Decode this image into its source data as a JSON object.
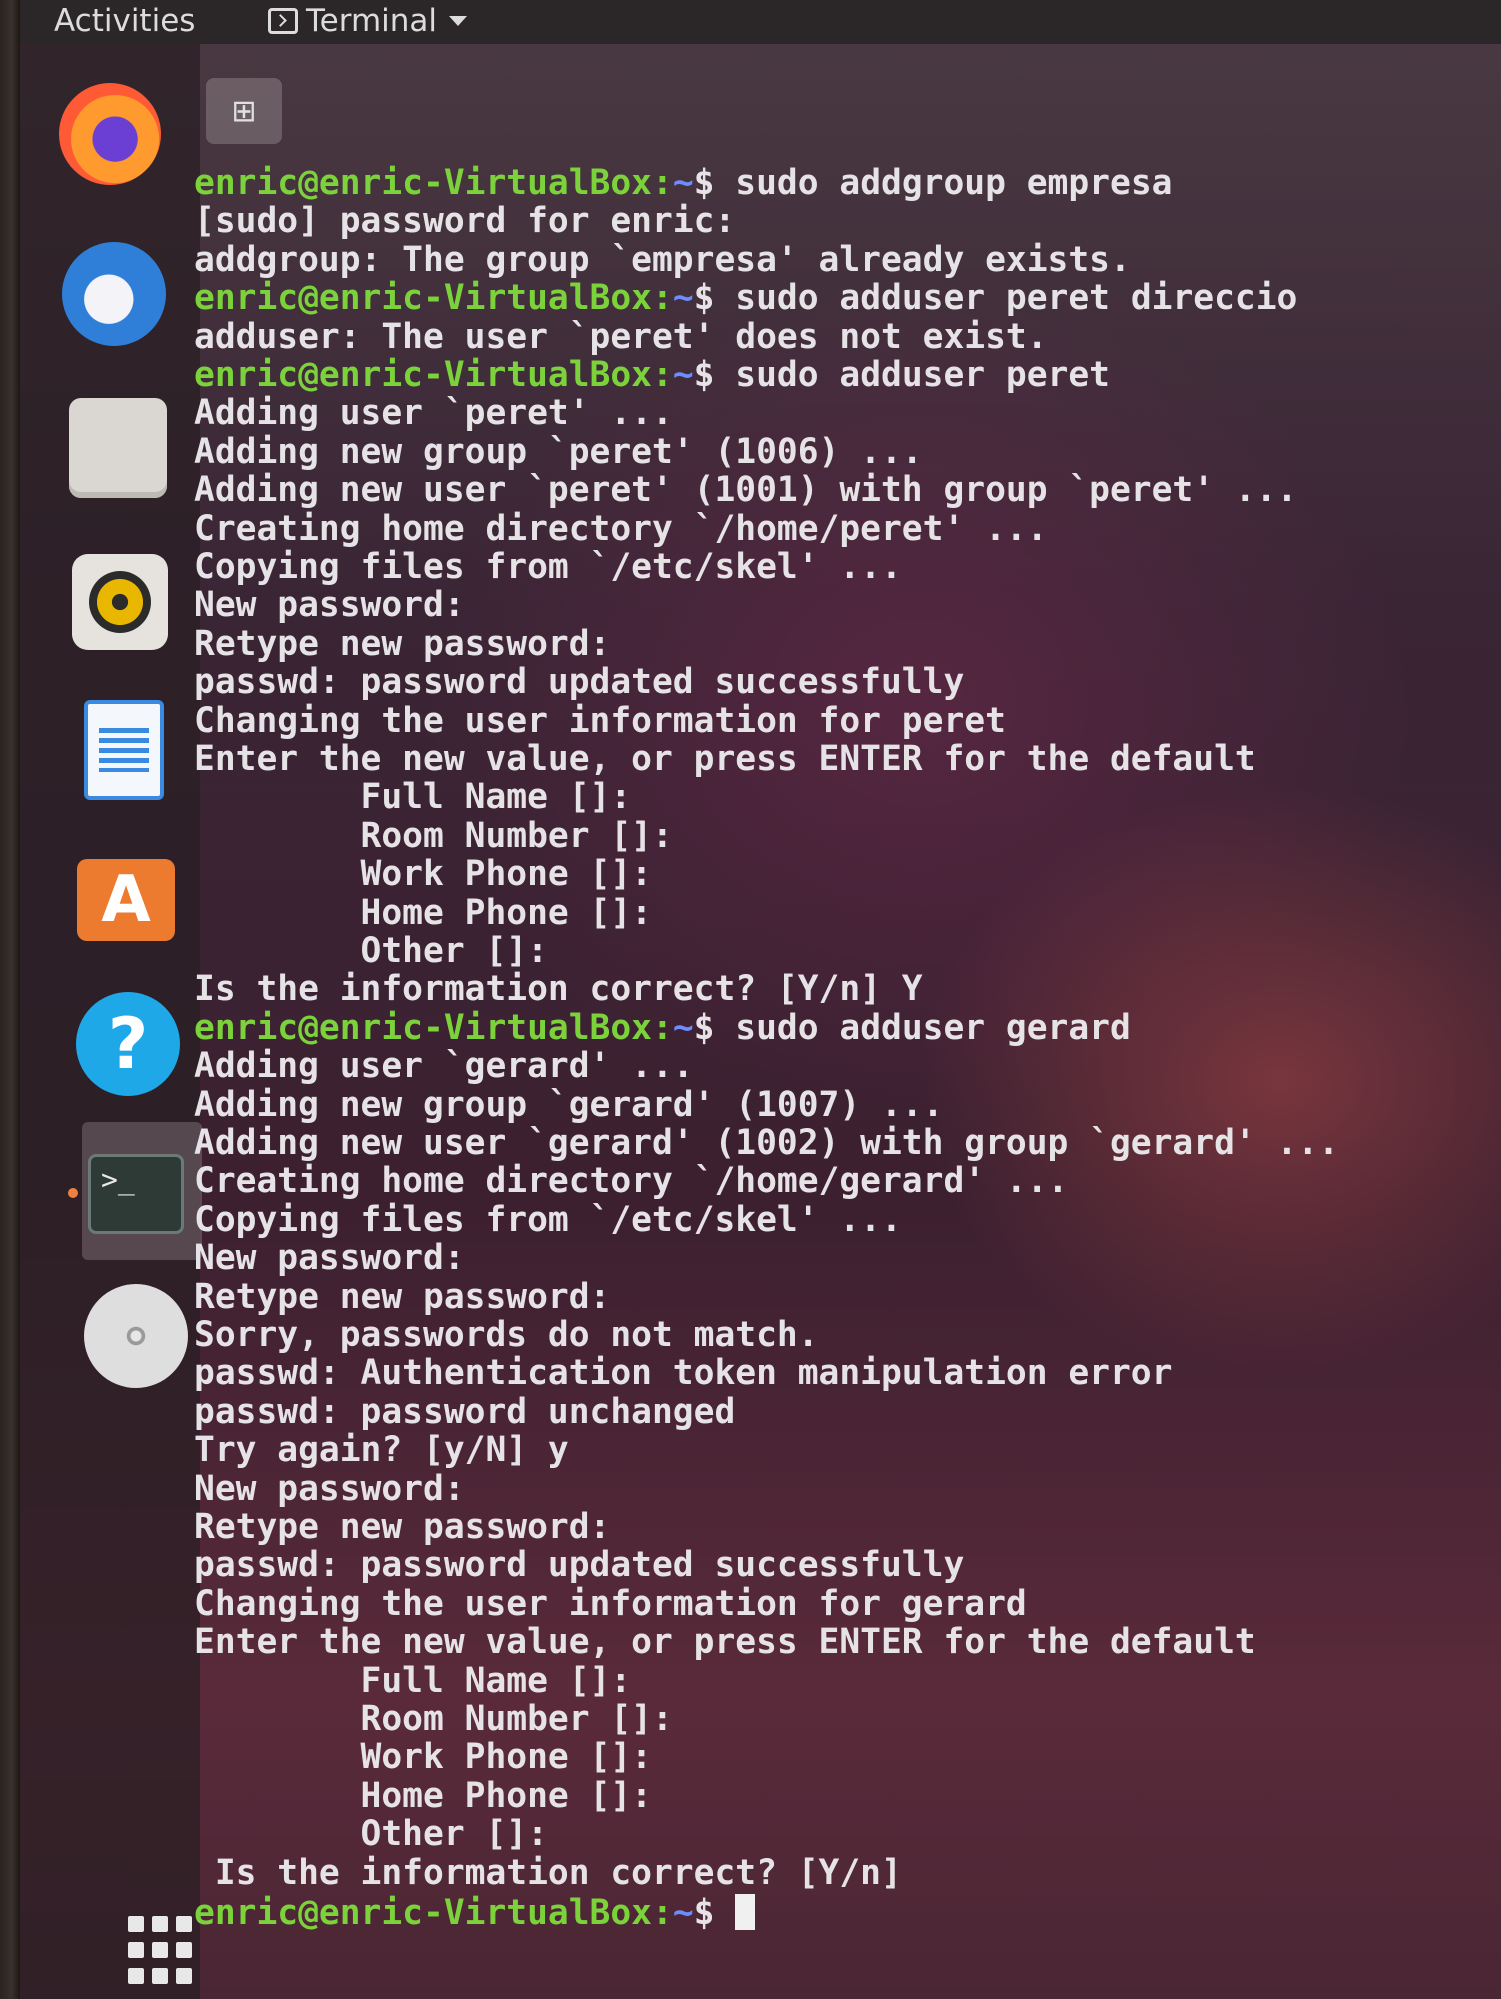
{
  "topbar": {
    "activities": "Activities",
    "app_name": "Terminal"
  },
  "dock": {
    "items": [
      {
        "name": "firefox-icon"
      },
      {
        "name": "thunderbird-icon"
      },
      {
        "name": "files-icon"
      },
      {
        "name": "rhythmbox-icon"
      },
      {
        "name": "libreoffice-writer-icon"
      },
      {
        "name": "ubuntu-software-icon"
      },
      {
        "name": "help-icon"
      },
      {
        "name": "terminal-icon"
      },
      {
        "name": "dvd-icon"
      },
      {
        "name": "show-applications-icon"
      }
    ],
    "help_glyph": "?",
    "software_glyph": "A",
    "terminal_glyph": ">_"
  },
  "terminal": {
    "new_tab_glyph": "⊞",
    "prompt_user": "enric@enric-VirtualBox:",
    "prompt_path": "~",
    "prompt_end": "$ ",
    "lines": [
      {
        "type": "cmd",
        "text": "sudo addgroup empresa"
      },
      {
        "type": "out",
        "text": "[sudo] password for enric:"
      },
      {
        "type": "out",
        "text": "addgroup: The group `empresa' already exists."
      },
      {
        "type": "cmd",
        "text": "sudo adduser peret direccio"
      },
      {
        "type": "out",
        "text": "adduser: The user `peret' does not exist."
      },
      {
        "type": "cmd",
        "text": "sudo adduser peret"
      },
      {
        "type": "out",
        "text": "Adding user `peret' ..."
      },
      {
        "type": "out",
        "text": "Adding new group `peret' (1006) ..."
      },
      {
        "type": "out",
        "text": "Adding new user `peret' (1001) with group `peret' ..."
      },
      {
        "type": "out",
        "text": "Creating home directory `/home/peret' ..."
      },
      {
        "type": "out",
        "text": "Copying files from `/etc/skel' ..."
      },
      {
        "type": "out",
        "text": "New password:"
      },
      {
        "type": "out",
        "text": "Retype new password:"
      },
      {
        "type": "out",
        "text": "passwd: password updated successfully"
      },
      {
        "type": "out",
        "text": "Changing the user information for peret"
      },
      {
        "type": "out",
        "text": "Enter the new value, or press ENTER for the default"
      },
      {
        "type": "out",
        "text": "        Full Name []:"
      },
      {
        "type": "out",
        "text": "        Room Number []:"
      },
      {
        "type": "out",
        "text": "        Work Phone []:"
      },
      {
        "type": "out",
        "text": "        Home Phone []:"
      },
      {
        "type": "out",
        "text": "        Other []:"
      },
      {
        "type": "out",
        "text": "Is the information correct? [Y/n] Y"
      },
      {
        "type": "cmd",
        "text": "sudo adduser gerard"
      },
      {
        "type": "out",
        "text": "Adding user `gerard' ..."
      },
      {
        "type": "out",
        "text": "Adding new group `gerard' (1007) ..."
      },
      {
        "type": "out",
        "text": "Adding new user `gerard' (1002) with group `gerard' ..."
      },
      {
        "type": "out",
        "text": "Creating home directory `/home/gerard' ..."
      },
      {
        "type": "out",
        "text": "Copying files from `/etc/skel' ..."
      },
      {
        "type": "out",
        "text": "New password:"
      },
      {
        "type": "out",
        "text": "Retype new password:"
      },
      {
        "type": "out",
        "text": "Sorry, passwords do not match."
      },
      {
        "type": "out",
        "text": "passwd: Authentication token manipulation error"
      },
      {
        "type": "out",
        "text": "passwd: password unchanged"
      },
      {
        "type": "out",
        "text": "Try again? [y/N] y"
      },
      {
        "type": "out",
        "text": "New password:"
      },
      {
        "type": "out",
        "text": "Retype new password:"
      },
      {
        "type": "out",
        "text": "passwd: password updated successfully"
      },
      {
        "type": "out",
        "text": "Changing the user information for gerard"
      },
      {
        "type": "out",
        "text": "Enter the new value, or press ENTER for the default"
      },
      {
        "type": "out",
        "text": "        Full Name []:"
      },
      {
        "type": "out",
        "text": "        Room Number []:"
      },
      {
        "type": "out",
        "text": "        Work Phone []:"
      },
      {
        "type": "out",
        "text": "        Home Phone []:"
      },
      {
        "type": "out",
        "text": "        Other []:"
      },
      {
        "type": "out",
        "text": " Is the information correct? [Y/n]"
      },
      {
        "type": "cmd",
        "text": ""
      }
    ]
  }
}
